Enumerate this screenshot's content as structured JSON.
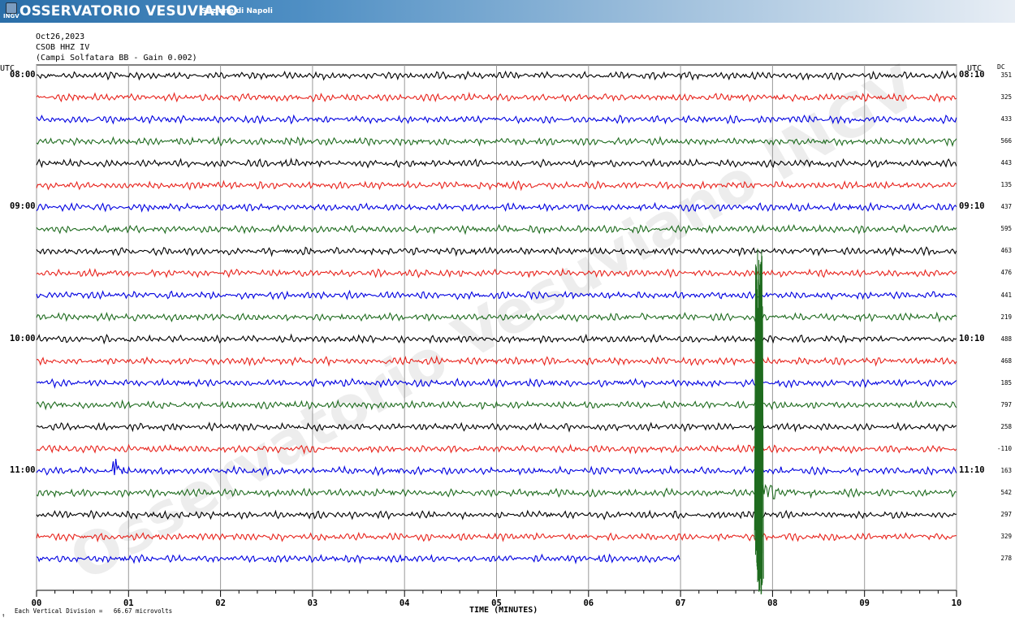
{
  "header": {
    "brand": "OSSERVATORIO VESUVIANO",
    "subtitle": "Sezione di Napoli",
    "logo_text": "INGV"
  },
  "info": {
    "date": "Oct26,2023",
    "station": "CSOB HHZ IV",
    "description": "(Campi Solfatara BB - Gain 0.002)"
  },
  "labels": {
    "utc_left": "UTC",
    "utc_right": "UTC",
    "dc": "DC",
    "footer": "Each Vertical Division =   66.67 microvolts",
    "footer_mark": "↑"
  },
  "watermark": "Osservatorio Vesuviano INGV",
  "colors": {
    "black": "#000000",
    "red": "#e8231c",
    "blue": "#0000e0",
    "green": "#1e6b1e",
    "grid": "#999999",
    "banner": "#2a6ea8"
  },
  "chart_data": {
    "type": "line",
    "title": "",
    "xlabel": "TIME (MINUTES)",
    "ylabel": "",
    "xlim": [
      0,
      10
    ],
    "x_ticks": [
      "00",
      "01",
      "02",
      "03",
      "04",
      "05",
      "06",
      "07",
      "08",
      "09",
      "10"
    ],
    "left_time_labels": [
      {
        "row": 0,
        "text": "08:00"
      },
      {
        "row": 6,
        "text": "09:00"
      },
      {
        "row": 12,
        "text": "10:00"
      },
      {
        "row": 18,
        "text": "11:00"
      }
    ],
    "right_time_labels": [
      {
        "row": 0,
        "text": "08:10"
      },
      {
        "row": 6,
        "text": "09:10"
      },
      {
        "row": 12,
        "text": "10:10"
      },
      {
        "row": 18,
        "text": "11:10"
      }
    ],
    "trace_color_cycle": [
      "black",
      "red",
      "blue",
      "green"
    ],
    "dc_offsets": [
      "351",
      "325",
      "433",
      "566",
      "443",
      "135",
      "437",
      "595",
      "463",
      "476",
      "441",
      "219",
      "488",
      "468",
      "185",
      "797",
      "258",
      "-110",
      "163",
      "542",
      "297",
      "329",
      "278"
    ],
    "last_trace_end_minute": 7.0,
    "events": [
      {
        "row": 18,
        "minute": 0.88,
        "type": "spike"
      },
      {
        "row": 12,
        "minute": 7.85,
        "type": "earthquake",
        "peak_rows": [
          10,
          23
        ],
        "coda_row": 19
      }
    ]
  }
}
